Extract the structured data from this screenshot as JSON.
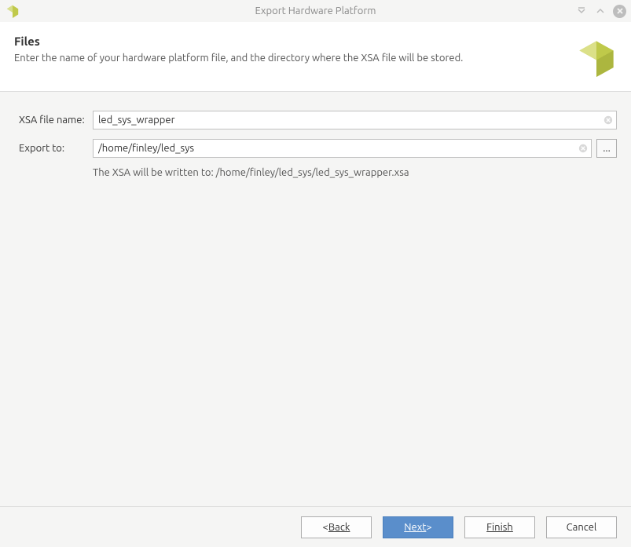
{
  "window": {
    "title": "Export Hardware Platform"
  },
  "header": {
    "title": "Files",
    "subtitle": "Enter the name of your hardware platform file, and the directory where the XSA file will be stored."
  },
  "form": {
    "xsa_label": "XSA file name:",
    "xsa_value": "led_sys_wrapper",
    "export_label": "Export to:",
    "export_value": "/home/finley/led_sys",
    "hint": "The XSA will be written to: /home/finley/led_sys/led_sys_wrapper.xsa",
    "browse_label": "..."
  },
  "buttons": {
    "back_prefix": "< ",
    "back": "Back",
    "next": "Next",
    "next_suffix": " >",
    "finish": "Finish",
    "cancel": "Cancel"
  }
}
